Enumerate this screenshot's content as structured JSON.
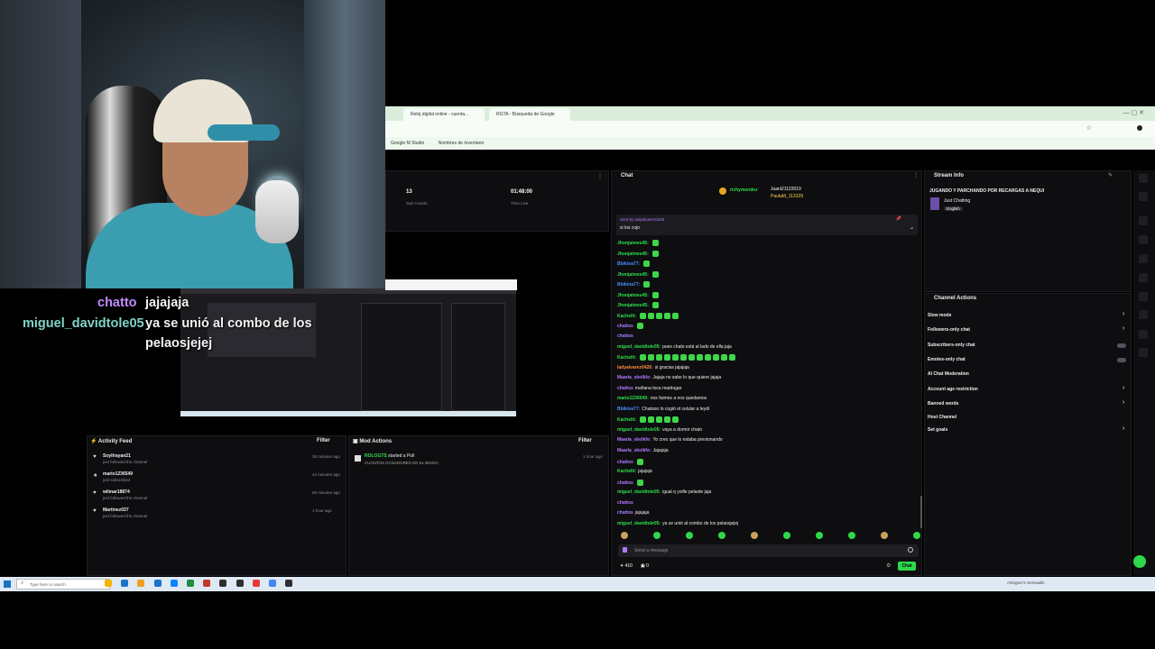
{
  "overlay_chat": [
    {
      "user": "chatto",
      "message": "jajajaja",
      "color": "#c08cff"
    },
    {
      "user": "miguel_davidtole05",
      "message": "ya se unió al combo de los",
      "message_cont": "pelaosjejej",
      "color": "#7fd3c7"
    }
  ],
  "browser": {
    "tabs": [
      "Reloj digital online - cuenta...",
      "RGTA - Búsqueda de Google"
    ],
    "bookmarks": [
      "Google M Studio",
      "Nombres de Inventario"
    ]
  },
  "stats": {
    "sub_count_value": "13",
    "sub_count_label": "Sub Counts",
    "time_live_value": "01:48:00",
    "time_live_label": "Time Live"
  },
  "chat": {
    "title": "Chat",
    "hype_users": [
      "richymendez",
      "Juani21122019",
      "PaulaM_113329"
    ],
    "pinned_label": "Sent by ladyalvarez0426",
    "pinned_message": "si los cojo",
    "lines": [
      {
        "user": "Jhonjaimes45:",
        "text": "",
        "cls": "u-green",
        "emotes": 1
      },
      {
        "user": "Jhonjaimes45:",
        "text": "",
        "cls": "u-green",
        "emotes": 1
      },
      {
        "user": "Bbikina77:",
        "text": "",
        "cls": "u-blue",
        "emotes": 1
      },
      {
        "user": "Jhonjaimes45:",
        "text": "",
        "cls": "u-green",
        "emotes": 1
      },
      {
        "user": "Bbikina77:",
        "text": "",
        "cls": "u-blue",
        "emotes": 1
      },
      {
        "user": "Jhonjaimes45:",
        "text": "",
        "cls": "u-green",
        "emotes": 1
      },
      {
        "user": "Jhonjaimes45:",
        "text": "",
        "cls": "u-green",
        "emotes": 1
      },
      {
        "user": "Kachelit:",
        "text": "",
        "cls": "u-green",
        "emotes": 5
      },
      {
        "user": "chattos",
        "text": "",
        "cls": "u-purple",
        "emotes": 1
      },
      {
        "user": "chattos",
        "text": "",
        "cls": "u-purple",
        "emotes": 0
      },
      {
        "user": "miguel_davidtole05:",
        "text": "pues chato está al lado de ella jaja",
        "cls": "u-green",
        "emotes": 0
      },
      {
        "user": "Kachelit:",
        "text": "",
        "cls": "u-green",
        "emotes": 12
      },
      {
        "user": "ladyalvarez0426:",
        "text": "si gracias jajajaja",
        "cls": "u-orange",
        "emotes": 0
      },
      {
        "user": "Maaria_skolkfe:",
        "text": "Jajaja no sabe lo que quiere jajaja",
        "cls": "u-purple",
        "emotes": 0
      },
      {
        "user": "chattos",
        "text": "mañana toca madrugar",
        "cls": "u-purple",
        "emotes": 0
      },
      {
        "user": "mario1236549:",
        "text": "nos fuimos a nos quedamos",
        "cls": "u-green",
        "emotes": 0
      },
      {
        "user": "Bbikina77:",
        "text": "Chatooo lo cogió el celular a leydi",
        "cls": "u-blue",
        "emotes": 0
      },
      {
        "user": "Kachelit:",
        "text": "",
        "cls": "u-green",
        "emotes": 5
      },
      {
        "user": "miguel_davidtole05:",
        "text": "vaya a dormir chato",
        "cls": "u-green",
        "emotes": 0
      },
      {
        "user": "Maaria_skolkfe:",
        "text": "Yo creo que lo estaba presionando",
        "cls": "u-purple",
        "emotes": 0
      },
      {
        "user": "Maaria_skolkfe:",
        "text": "Jajajaja",
        "cls": "u-purple",
        "emotes": 0
      },
      {
        "user": "chattos",
        "text": "",
        "cls": "u-purple",
        "emotes": 1
      },
      {
        "user": "Kachelit:",
        "text": "jajajaja",
        "cls": "u-green",
        "emotes": 0
      },
      {
        "user": "chattos",
        "text": "",
        "cls": "u-purple",
        "emotes": 1
      },
      {
        "user": "miguel_davidtole05:",
        "text": "igual q yoille pelaste jaja",
        "cls": "u-green",
        "emotes": 0
      },
      {
        "user": "chattos",
        "text": "",
        "cls": "u-purple",
        "emotes": 0
      },
      {
        "user": "chattos",
        "text": "jajajaja",
        "cls": "u-purple",
        "emotes": 0
      },
      {
        "user": "miguel_davidtole05:",
        "text": "ya se unió al combo de los pelaosjejej",
        "cls": "u-green",
        "emotes": 0
      }
    ],
    "input_placeholder": "Send a message",
    "points": "410",
    "bits": "0",
    "send_label": "Chat"
  },
  "stream_info": {
    "title": "Stream Info",
    "stream_title": "JUGANDO Y PARCHANDO POR RECARGAS A NEQUI",
    "category": "Just Chatting",
    "language": "English"
  },
  "channel_actions": {
    "title": "Channel Actions",
    "items": [
      "Slow mode",
      "Followers-only chat",
      "Subscribers-only chat",
      "Emotes-only chat",
      "AI Chat Moderation",
      "Account age restriction",
      "Banned words",
      "Host Channel",
      "Set goals"
    ]
  },
  "activity_feed": {
    "title": "Activity Feed",
    "filter": "Filter",
    "items": [
      {
        "user": "Soyllrayan21",
        "action": "just followed the channel",
        "time": "26 minutes ago"
      },
      {
        "user": "mario1236549",
        "action": "just subscribed",
        "time": "44 minutes ago"
      },
      {
        "user": "wilmar18874",
        "action": "just followed the channel",
        "time": "59 minutes ago"
      },
      {
        "user": "Martinez037",
        "action": "just followed the channel",
        "time": "1 hour ago"
      }
    ]
  },
  "mod_actions": {
    "title": "Mod Actions",
    "filter": "Filter",
    "items": [
      {
        "user": "ROLOGTS",
        "action": "started a Poll",
        "detail": "CUANTOS GANADORES EN EL BINGO",
        "time": "1 hour ago"
      }
    ]
  },
  "taskbar": {
    "search_placeholder": "Type here to search",
    "tray_text": "Arlington's Semwalls"
  }
}
